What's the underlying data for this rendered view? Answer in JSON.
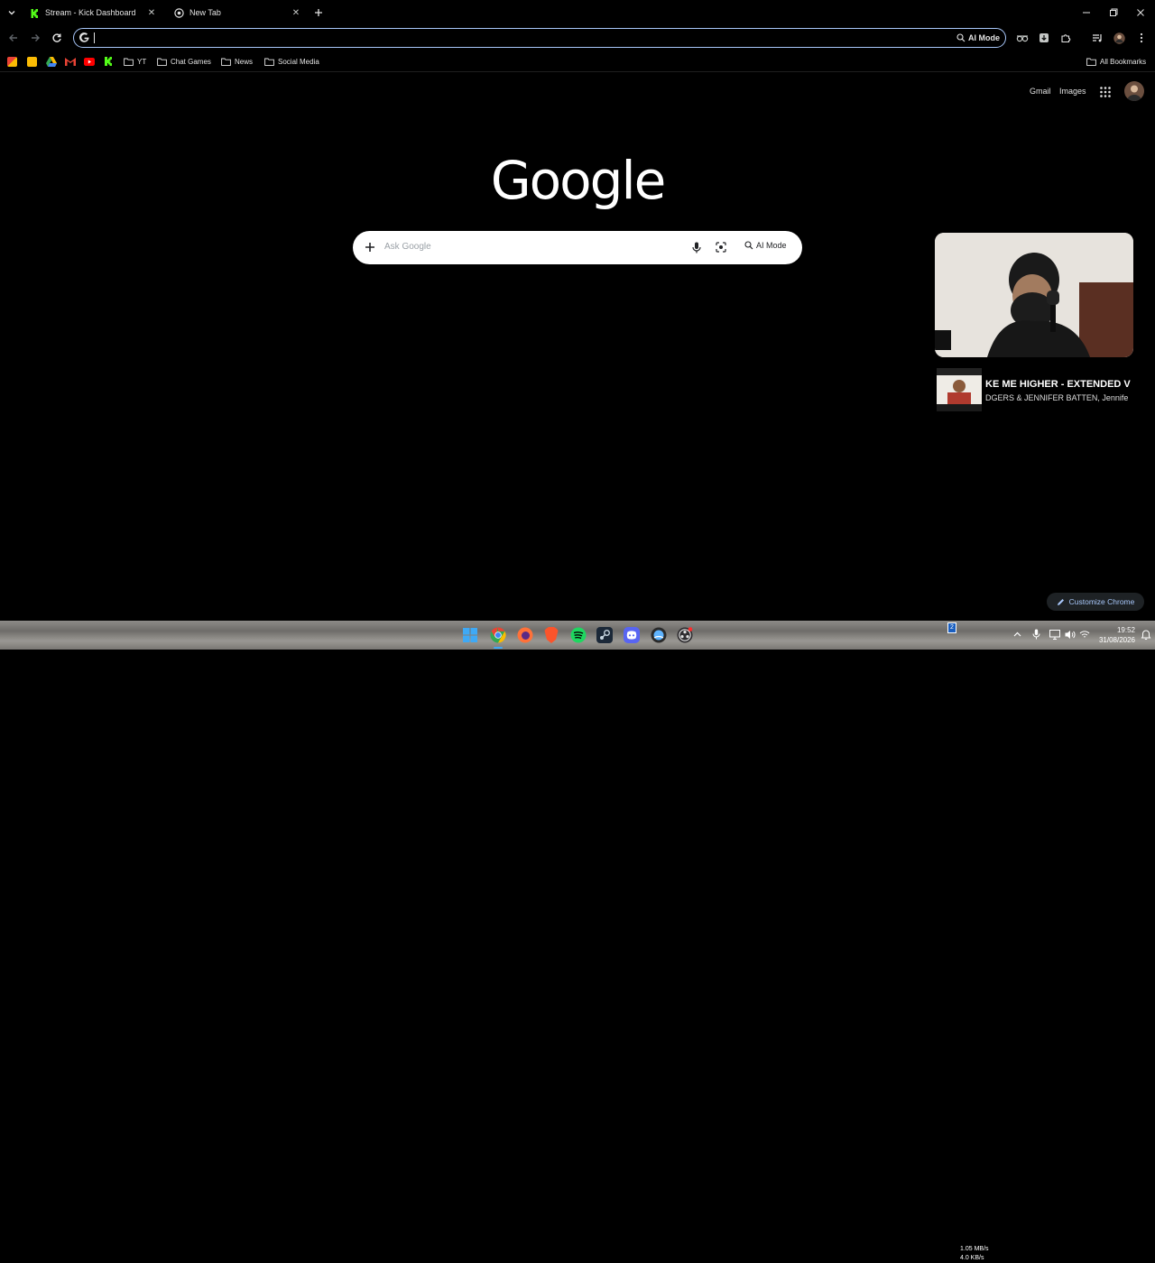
{
  "tabs": [
    {
      "title": "Stream - Kick Dashboard",
      "favicon": "kick-icon",
      "active": false
    },
    {
      "title": "New Tab",
      "favicon": "chrome-newtab-icon",
      "active": true
    }
  ],
  "omnibox": {
    "value": "",
    "ai_mode_label": "AI Mode"
  },
  "bookmarks": {
    "folders": [
      "YT",
      "Chat Games",
      "News",
      "Social Media"
    ],
    "all_bookmarks_label": "All Bookmarks"
  },
  "page": {
    "gmail_label": "Gmail",
    "images_label": "Images",
    "logo_text": "Google",
    "search_placeholder": "Ask Google",
    "ai_mode_label": "AI Mode",
    "customize_label": "Customize Chrome"
  },
  "now_playing": {
    "title": "KE ME HIGHER - EXTENDED V",
    "artist": "DGERS & JENNIFER BATTEN, Jennife"
  },
  "taskbar": {
    "net_up": "1.05 MB/s",
    "net_down": "4.0 KB/s",
    "time": "19:52",
    "date": "31/08/2026"
  },
  "colors": {
    "accent": "#a8c7fa",
    "kick_green": "#53fc18",
    "background": "#000000"
  }
}
